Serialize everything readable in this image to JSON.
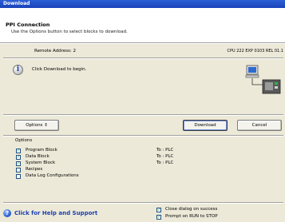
{
  "window": {
    "title": "Download"
  },
  "header": {
    "title": "PPI Connection",
    "subtitle": "Use the Options button to select blocks to download."
  },
  "connection": {
    "remote_address": "Remote Address: 2",
    "cpu_info": "CPU 222 EXP 0103 REL 01.1"
  },
  "info": {
    "icon": "info-icon",
    "message": "Click Download to begin."
  },
  "buttons": {
    "options": "Options",
    "options_arrow": "⇕",
    "download": "Download",
    "cancel": "Cancel"
  },
  "options": {
    "title": "Options",
    "items": [
      {
        "label": "Program Block",
        "checked": true,
        "target": "To : PLC"
      },
      {
        "label": "Data Block",
        "checked": true,
        "target": "To : PLC"
      },
      {
        "label": "System Block",
        "checked": true,
        "target": "To : PLC"
      },
      {
        "label": "Recipes",
        "checked": false,
        "target": ""
      },
      {
        "label": "Data Log Configurations",
        "checked": false,
        "target": ""
      }
    ]
  },
  "footer": {
    "help_link": "Click for Help and Support",
    "close_dialog": {
      "label": "Close dialog on success",
      "checked": true
    },
    "prompt_stop": {
      "label": "Prompt on RUN to STOP",
      "checked": true
    }
  },
  "colors": {
    "titlebar": "#1a43b8",
    "panel": "#ece9d8",
    "link": "#1c3fb0"
  }
}
